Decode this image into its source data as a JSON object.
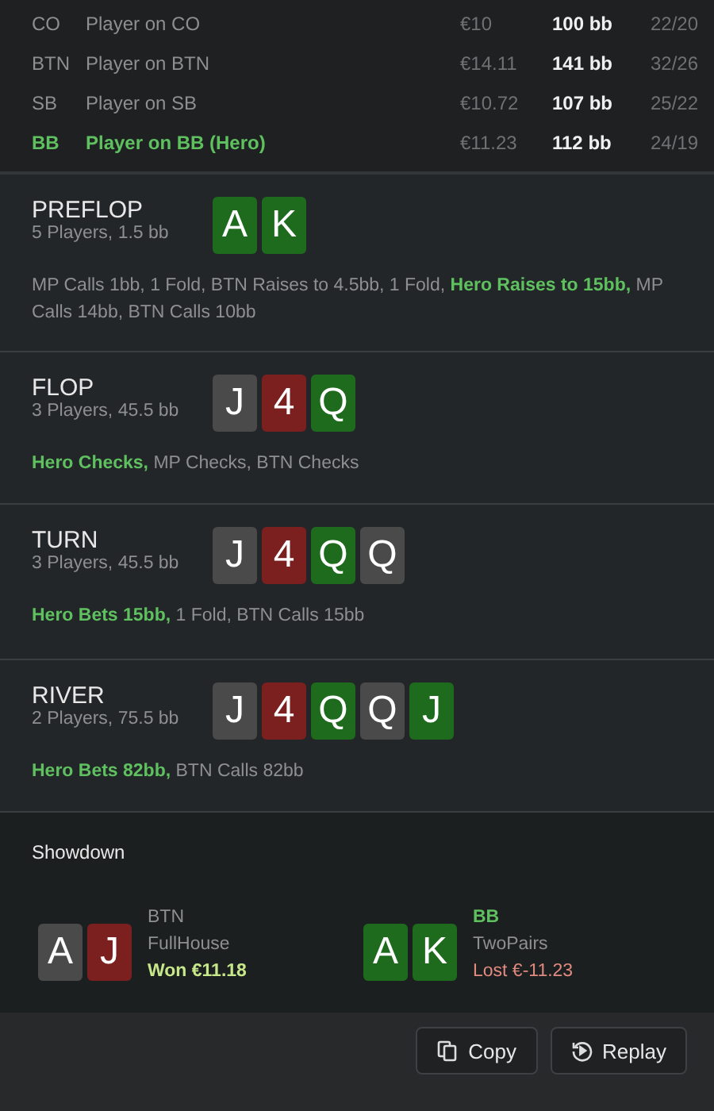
{
  "players": [
    {
      "position": "CO",
      "name": "Player on CO",
      "money": "€10",
      "stack": "100 bb",
      "stats": "22/20",
      "hero": false
    },
    {
      "position": "BTN",
      "name": "Player on BTN",
      "money": "€14.11",
      "stack": "141 bb",
      "stats": "32/26",
      "hero": false
    },
    {
      "position": "SB",
      "name": "Player on SB",
      "money": "€10.72",
      "stack": "107 bb",
      "stats": "25/22",
      "hero": false
    },
    {
      "position": "BB",
      "name": "Player on BB (Hero)",
      "money": "€11.23",
      "stack": "112 bb",
      "stats": "24/19",
      "hero": true
    }
  ],
  "streets": [
    {
      "name": "PREFLOP",
      "info": "5 Players, 1.5 bb",
      "cards": [
        {
          "rank": "A",
          "color": "#1e6b1e"
        },
        {
          "rank": "K",
          "color": "#1e6b1e"
        }
      ],
      "actions": "MP Calls 1bb, 1 Fold, BTN Raises to 4.5bb, 1 Fold, **Hero Raises to 15bb,** MP Calls 14bb, BTN Calls 10bb"
    },
    {
      "name": "FLOP",
      "info": "3 Players, 45.5 bb",
      "cards": [
        {
          "rank": "J",
          "color": "#4a4a4a"
        },
        {
          "rank": "4",
          "color": "#7b1f1f"
        },
        {
          "rank": "Q",
          "color": "#1e6b1e"
        }
      ],
      "actions": "**Hero Checks,** MP Checks, BTN Checks"
    },
    {
      "name": "TURN",
      "info": "3 Players, 45.5 bb",
      "cards": [
        {
          "rank": "J",
          "color": "#4a4a4a"
        },
        {
          "rank": "4",
          "color": "#7b1f1f"
        },
        {
          "rank": "Q",
          "color": "#1e6b1e"
        },
        {
          "rank": "Q",
          "color": "#4a4a4a"
        }
      ],
      "actions": "**Hero Bets 15bb,** 1 Fold, BTN Calls 15bb"
    },
    {
      "name": "RIVER",
      "info": "2 Players, 75.5 bb",
      "cards": [
        {
          "rank": "J",
          "color": "#4a4a4a"
        },
        {
          "rank": "4",
          "color": "#7b1f1f"
        },
        {
          "rank": "Q",
          "color": "#1e6b1e"
        },
        {
          "rank": "Q",
          "color": "#4a4a4a"
        },
        {
          "rank": "J",
          "color": "#1e6b1e"
        }
      ],
      "actions": "**Hero Bets 82bb,** BTN Calls 82bb"
    }
  ],
  "showdown": {
    "title": "Showdown",
    "hands": [
      {
        "position": "BTN",
        "hero": false,
        "cards": [
          {
            "rank": "A",
            "color": "#4a4a4a"
          },
          {
            "rank": "J",
            "color": "#7b1f1f"
          }
        ],
        "hand": "FullHouse",
        "result": "Won €11.18",
        "won": true
      },
      {
        "position": "BB",
        "hero": true,
        "cards": [
          {
            "rank": "A",
            "color": "#1e6b1e"
          },
          {
            "rank": "K",
            "color": "#1e6b1e"
          }
        ],
        "hand": "TwoPairs",
        "result": "Lost €-11.23",
        "won": false
      }
    ]
  },
  "buttons": [
    {
      "label": "Copy"
    },
    {
      "label": "Replay"
    }
  ]
}
